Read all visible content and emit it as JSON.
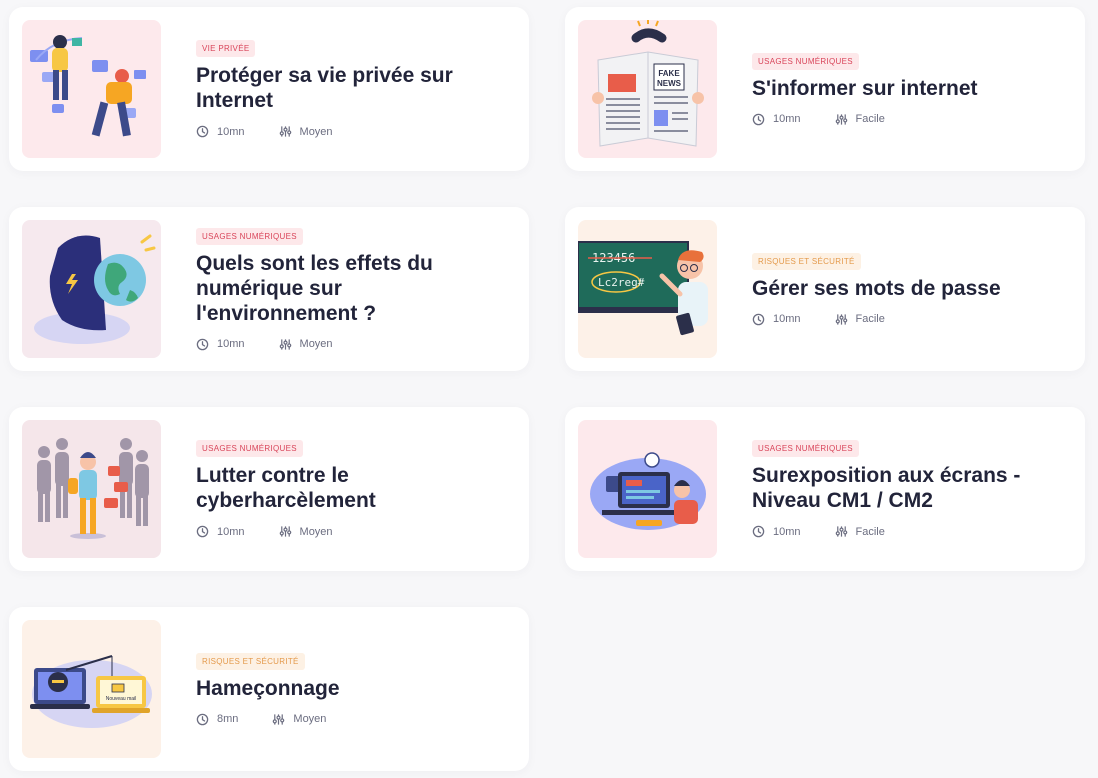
{
  "cards": [
    {
      "tag": "VIE PRIVÉE",
      "title": "Protéger sa vie privée sur Internet",
      "duration": "10mn",
      "level": "Moyen",
      "image": "privacy-illustration"
    },
    {
      "tag": "USAGES NUMÉRIQUES",
      "title": "S'informer sur internet",
      "duration": "10mn",
      "level": "Facile",
      "image": "fake-news-newspaper-illustration"
    },
    {
      "tag": "USAGES NUMÉRIQUES",
      "title": "Quels sont les effets du numérique sur l'environnement ?",
      "duration": "10mn",
      "level": "Moyen",
      "image": "planet-screen-illustration"
    },
    {
      "tag": "RISQUES ET SÉCURITÉ",
      "title": "Gérer ses mots de passe",
      "duration": "10mn",
      "level": "Facile",
      "image": "password-blackboard-illustration"
    },
    {
      "tag": "USAGES NUMÉRIQUES",
      "title": "Lutter contre le cyberharcèlement",
      "duration": "10mn",
      "level": "Moyen",
      "image": "cyberbullying-illustration"
    },
    {
      "tag": "USAGES NUMÉRIQUES",
      "title": "Surexposition aux écrans - Niveau CM1 / CM2",
      "duration": "10mn",
      "level": "Facile",
      "image": "screen-overexposure-illustration"
    },
    {
      "tag": "RISQUES ET SÉCURITÉ",
      "title": "Hameçonnage",
      "duration": "8mn",
      "level": "Moyen",
      "image": "phishing-illustration",
      "thumb_text": "Nouveau mail"
    }
  ],
  "colors": {
    "tag_pink_bg": "#fde8ea",
    "tag_pink_text": "#d9455a",
    "tag_orange_bg": "#fdf1e4",
    "tag_orange_text": "#e49a4c",
    "title": "#22243a",
    "meta": "#6b6d80"
  },
  "icons": {
    "duration": "clock-icon",
    "level": "sliders-icon"
  }
}
